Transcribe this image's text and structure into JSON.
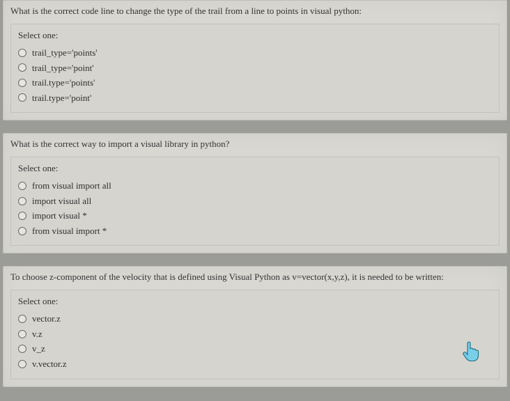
{
  "questions": [
    {
      "text": "What is the correct code line to change the type of the trail from a line to points in visual python:",
      "prompt": "Select one:",
      "options": [
        "trail_type='points'",
        "trail_type='point'",
        "trail.type='points'",
        "trail.type='point'"
      ]
    },
    {
      "text": "What is the correct way to import a visual library in python?",
      "prompt": "Select one:",
      "options": [
        "from visual import all",
        "import visual all",
        "import visual *",
        "from visual import *"
      ]
    },
    {
      "text": "To choose z-component of the velocity that is defined using Visual Python as v=vector(x,y,z), it is needed to be written:",
      "prompt": "Select one:",
      "options": [
        "vector.z",
        "v.z",
        "v_z",
        "v.vector.z"
      ]
    }
  ]
}
